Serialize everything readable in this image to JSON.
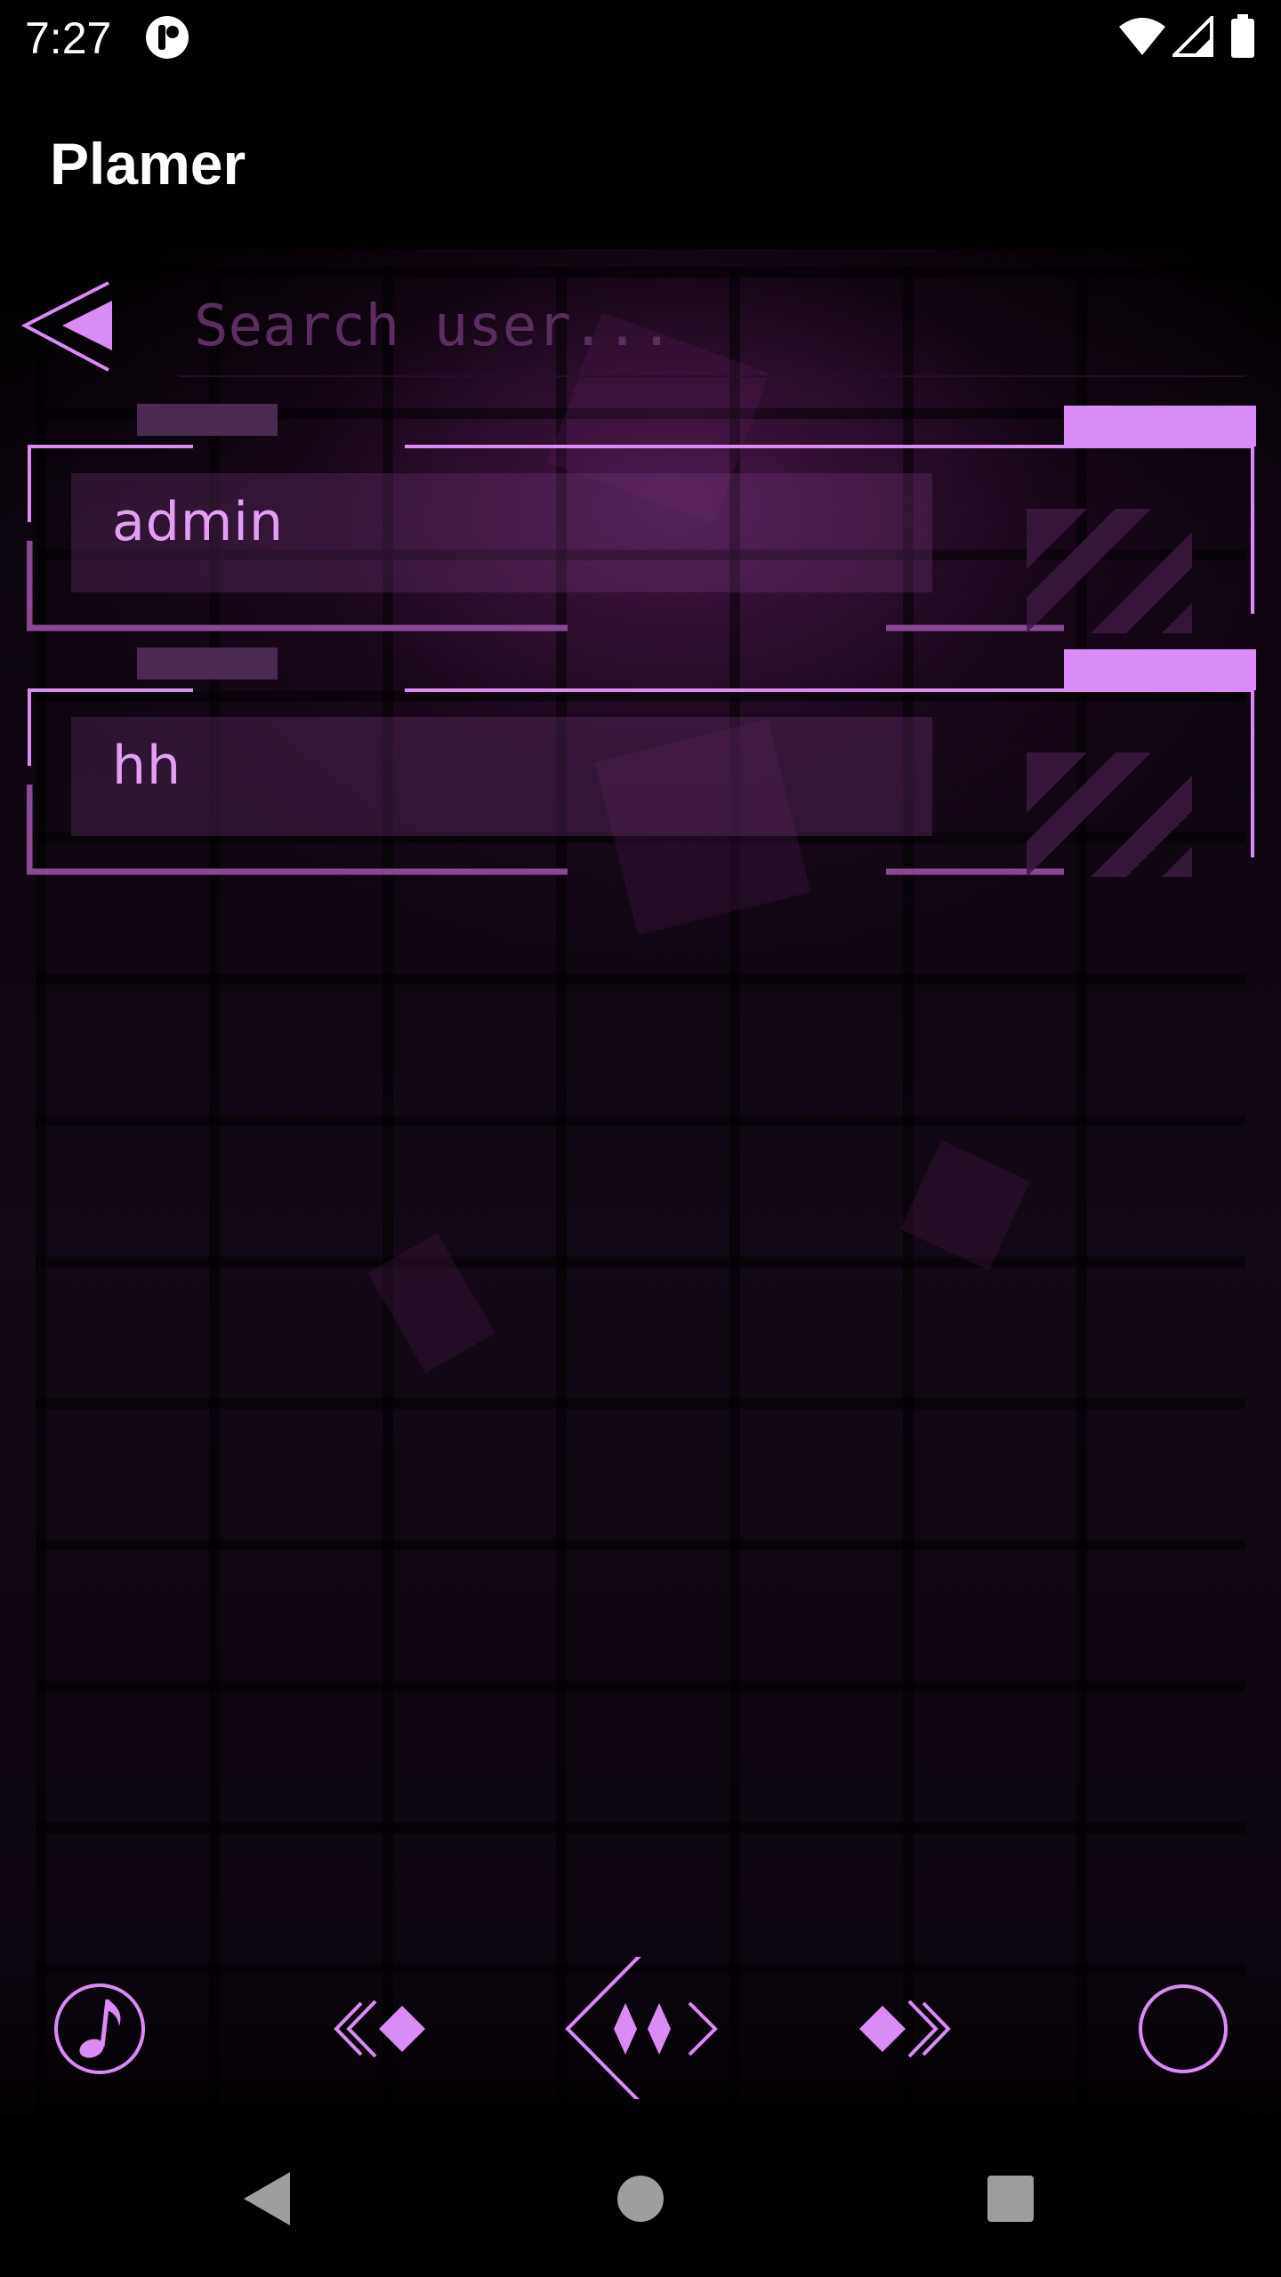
{
  "status_bar": {
    "time": "7:27",
    "icons": [
      "app-notification-icon",
      "wifi-icon",
      "signal-icon",
      "battery-icon"
    ]
  },
  "app_bar": {
    "title": "Plamer"
  },
  "search": {
    "placeholder": "Search user...",
    "value": ""
  },
  "users": [
    {
      "name": "admin"
    },
    {
      "name": "hh"
    }
  ],
  "bottom_nav": {
    "items": [
      "music-note-icon",
      "rewind-icon",
      "play-pause-icon",
      "fast-forward-icon",
      "circle-icon"
    ]
  },
  "system_nav": {
    "items": [
      "back-icon",
      "home-icon",
      "recents-icon"
    ]
  },
  "colors": {
    "accent": "#d98cf5",
    "accent_dim": "#8a4a93",
    "placeholder": "#5a2f5f",
    "background": "#000000"
  }
}
